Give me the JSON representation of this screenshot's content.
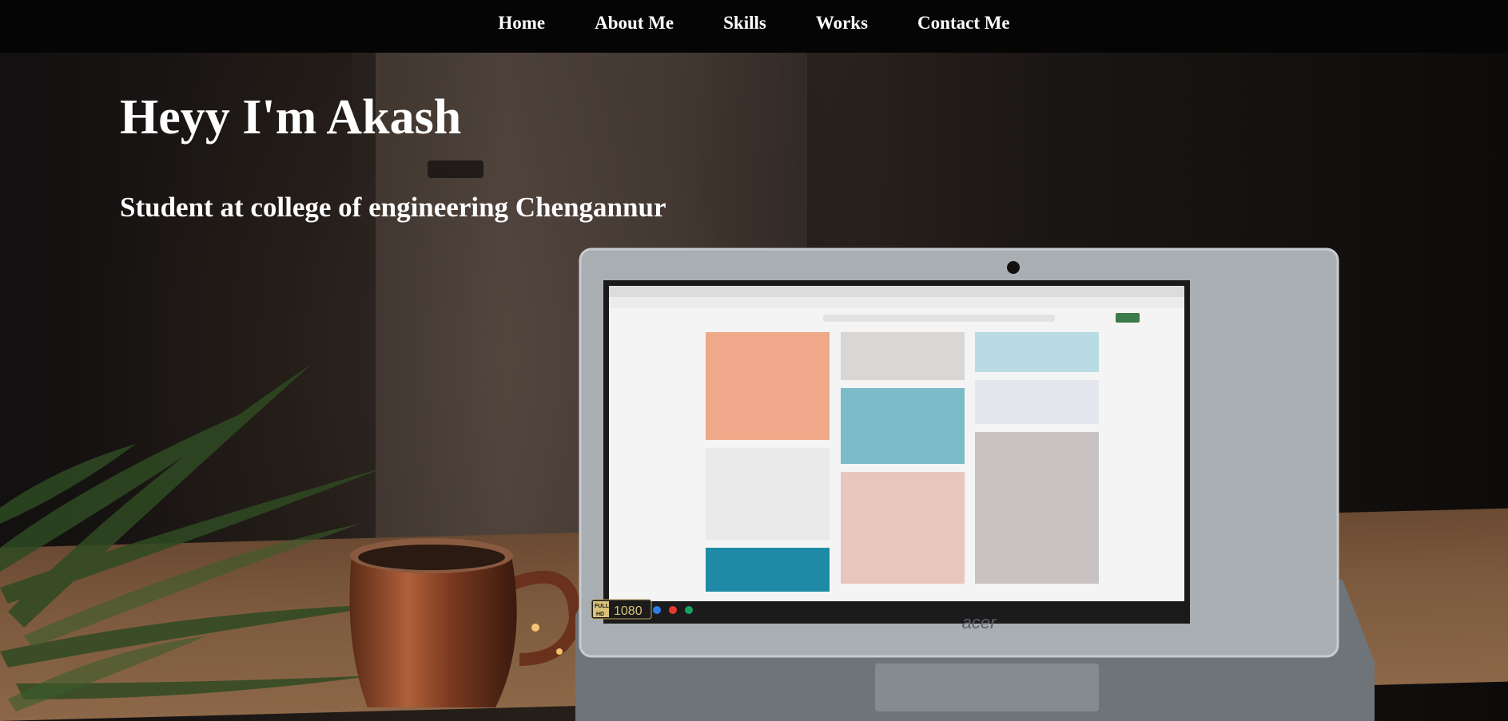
{
  "nav": {
    "items": [
      {
        "label": "Home"
      },
      {
        "label": "About Me"
      },
      {
        "label": "Skills"
      },
      {
        "label": "Works"
      },
      {
        "label": "Contact Me"
      }
    ]
  },
  "hero": {
    "title": "Heyy I'm Akash",
    "subtitle": "Student at college of engineering Chengannur"
  },
  "background_photo": {
    "laptop_brand": "acer",
    "badge_full": "FULL",
    "badge_hd": "HD",
    "badge_resolution": "1080"
  },
  "colors": {
    "navbar_bg": "#050505",
    "text": "#ffffff"
  }
}
